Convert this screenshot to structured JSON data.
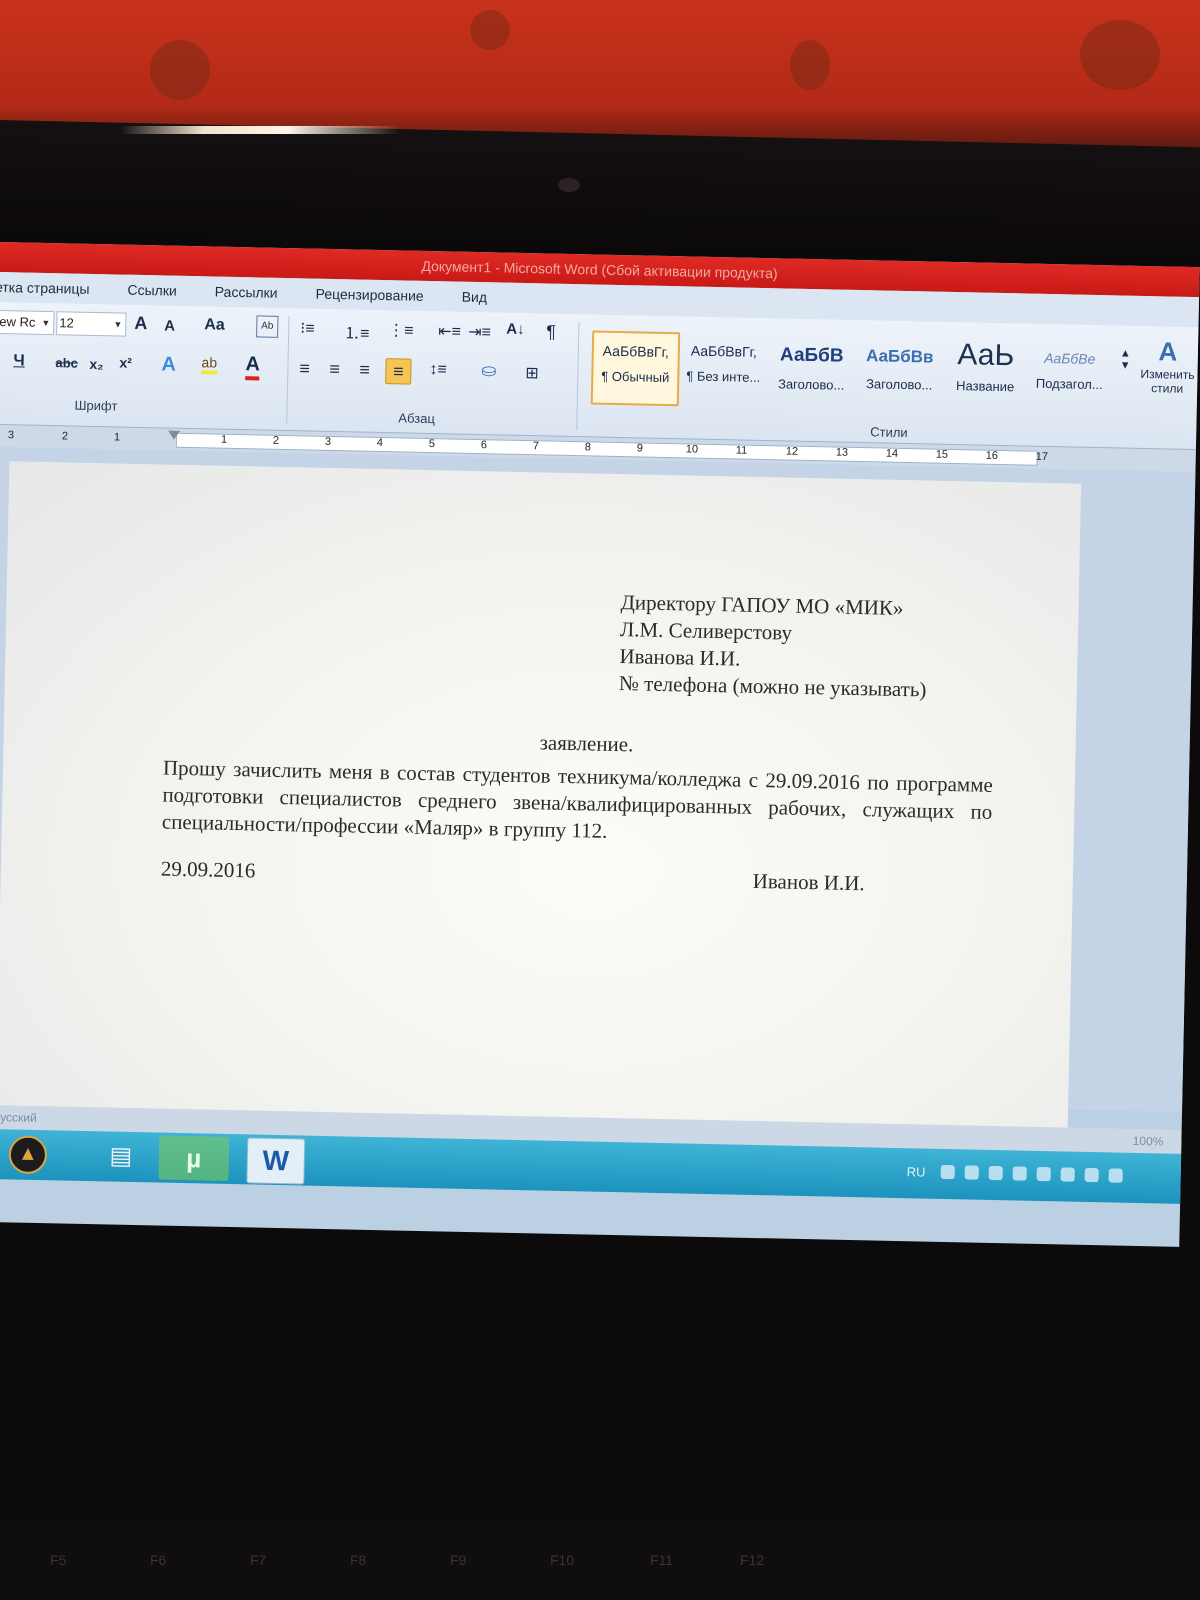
{
  "window": {
    "title": "Документ1 - Microsoft Word (Сбой активации продукта)"
  },
  "ribbon_tabs": [
    "етка страницы",
    "Ссылки",
    "Рассылки",
    "Рецензирование",
    "Вид"
  ],
  "font": {
    "name_value": "ew Rc",
    "size_value": "12",
    "grow_label": "A",
    "shrink_label": "A",
    "case_label": "Aa",
    "underline_label": "Ч",
    "strike_label": "abc",
    "subscript_label": "x₂",
    "superscript_label": "x²",
    "group_label": "Шрифт"
  },
  "paragraph": {
    "group_label": "Абзац"
  },
  "styles": {
    "group_label": "Стили",
    "items": [
      {
        "sample": "АаБбВвГг,",
        "name": "¶ Обычный"
      },
      {
        "sample": "АаБбВвГг,",
        "name": "¶ Без инте..."
      },
      {
        "sample": "АаБбВ",
        "name": "Заголово..."
      },
      {
        "sample": "АаБбВв",
        "name": "Заголово..."
      },
      {
        "sample": "АаЬ",
        "name": "Название"
      },
      {
        "sample": "АаБбВе",
        "name": "Подзагол..."
      }
    ],
    "change_label": "Изменить стили"
  },
  "ruler": {
    "left_numbers": [
      "3",
      "2",
      "1"
    ],
    "right_numbers": [
      "1",
      "2",
      "3",
      "4",
      "5",
      "6",
      "7",
      "8",
      "9",
      "10",
      "11",
      "12",
      "13",
      "14",
      "15",
      "16",
      "17"
    ]
  },
  "document": {
    "addressee": [
      "Директору ГАПОУ МО «МИК»",
      "Л.М. Селиверстову",
      "Иванова И.И.",
      "№ телефона (можно не указывать)"
    ],
    "heading": "заявление.",
    "body": "Прошу зачислить меня в состав студентов техникума/колледжа с 29.09.2016 по программе подготовки специалистов среднего звена/квалифицированных рабочих, служащих по специальности/профессии «Маляр» в группу 112.",
    "date": "29.09.2016",
    "signature": "Иванов И.И."
  },
  "status": {
    "language": "русский",
    "zoom": "100%"
  },
  "taskbar": {
    "lang": "RU",
    "word_label": "W"
  },
  "keyboard": {
    "keys": [
      "F5",
      "F6",
      "F7",
      "F8",
      "F9",
      "F10",
      "F11",
      "F12"
    ]
  }
}
